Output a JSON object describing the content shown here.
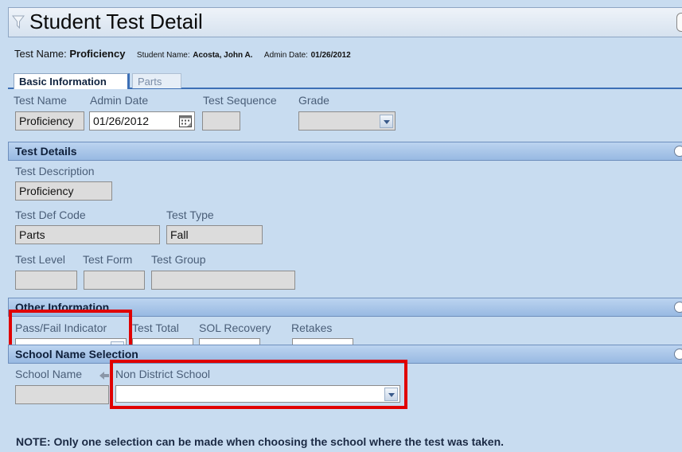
{
  "page": {
    "title": "Student Test Detail"
  },
  "header": {
    "test_name_label": "Test Name:",
    "test_name_value": "Proficiency",
    "student_name_label": "Student Name:",
    "student_name_value": "Acosta, John A.",
    "admin_date_label": "Admin Date:",
    "admin_date_value": "01/26/2012"
  },
  "tabs": [
    {
      "label": "Basic Information",
      "active": true
    },
    {
      "label": "Parts",
      "active": false
    }
  ],
  "basic": {
    "test_name_label": "Test Name",
    "admin_date_label": "Admin Date",
    "test_sequence_label": "Test Sequence",
    "grade_label": "Grade",
    "test_name_value": "Proficiency",
    "admin_date_value": "01/26/2012",
    "test_sequence_value": "",
    "grade_value": ""
  },
  "test_details": {
    "title": "Test Details",
    "description_label": "Test Description",
    "description_value": "Proficiency",
    "def_code_label": "Test Def Code",
    "def_code_value": "Parts",
    "type_label": "Test Type",
    "type_value": "Fall",
    "level_label": "Test Level",
    "form_label": "Test Form",
    "group_label": "Test Group",
    "level_value": "",
    "form_value": "",
    "group_value": ""
  },
  "other_info": {
    "title": "Other Information",
    "pass_fail_label": "Pass/Fail Indicator",
    "test_total_label": "Test Total",
    "sol_recovery_label": "SOL Recovery",
    "retakes_label": "Retakes",
    "pass_fail_value": "",
    "test_total_value": "",
    "sol_recovery_value": "",
    "retakes_value": ""
  },
  "school_selection": {
    "title": "School Name Selection",
    "school_name_label": "School Name",
    "non_district_label": "Non District School",
    "school_name_value": "",
    "non_district_value": ""
  },
  "note": "NOTE: Only one selection can be made when choosing the school where the test was taken.",
  "colors": {
    "highlight": "#e00000",
    "section_bar": "#98b9e2",
    "background": "#c8dcf0"
  }
}
